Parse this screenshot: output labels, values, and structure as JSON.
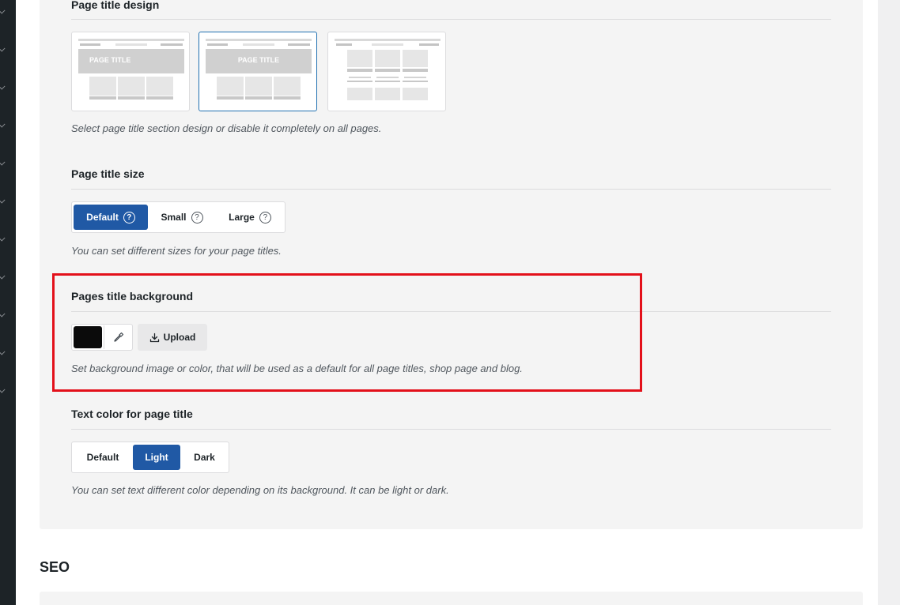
{
  "page_title_design": {
    "title": "Page title design",
    "card_label": "PAGE TITLE",
    "description": "Select page title section design or disable it completely on all pages."
  },
  "page_title_size": {
    "title": "Page title size",
    "options": [
      "Default",
      "Small",
      "Large"
    ],
    "selected": "Default",
    "help_glyph": "?",
    "description": "You can set different sizes for your page titles."
  },
  "pages_title_background": {
    "title": "Pages title background",
    "color": "#0b0b0b",
    "upload_label": "Upload",
    "description": "Set background image or color, that will be used as a default for all page titles, shop page and blog."
  },
  "text_color": {
    "title": "Text color for page title",
    "options": [
      "Default",
      "Light",
      "Dark"
    ],
    "selected": "Light",
    "description": "You can set text different color depending on its background. It can be light or dark."
  },
  "seo": {
    "title": "SEO"
  },
  "colors": {
    "accent": "#2059a5",
    "highlight_border": "#e3101a",
    "selected_card_border": "#2271b1"
  }
}
